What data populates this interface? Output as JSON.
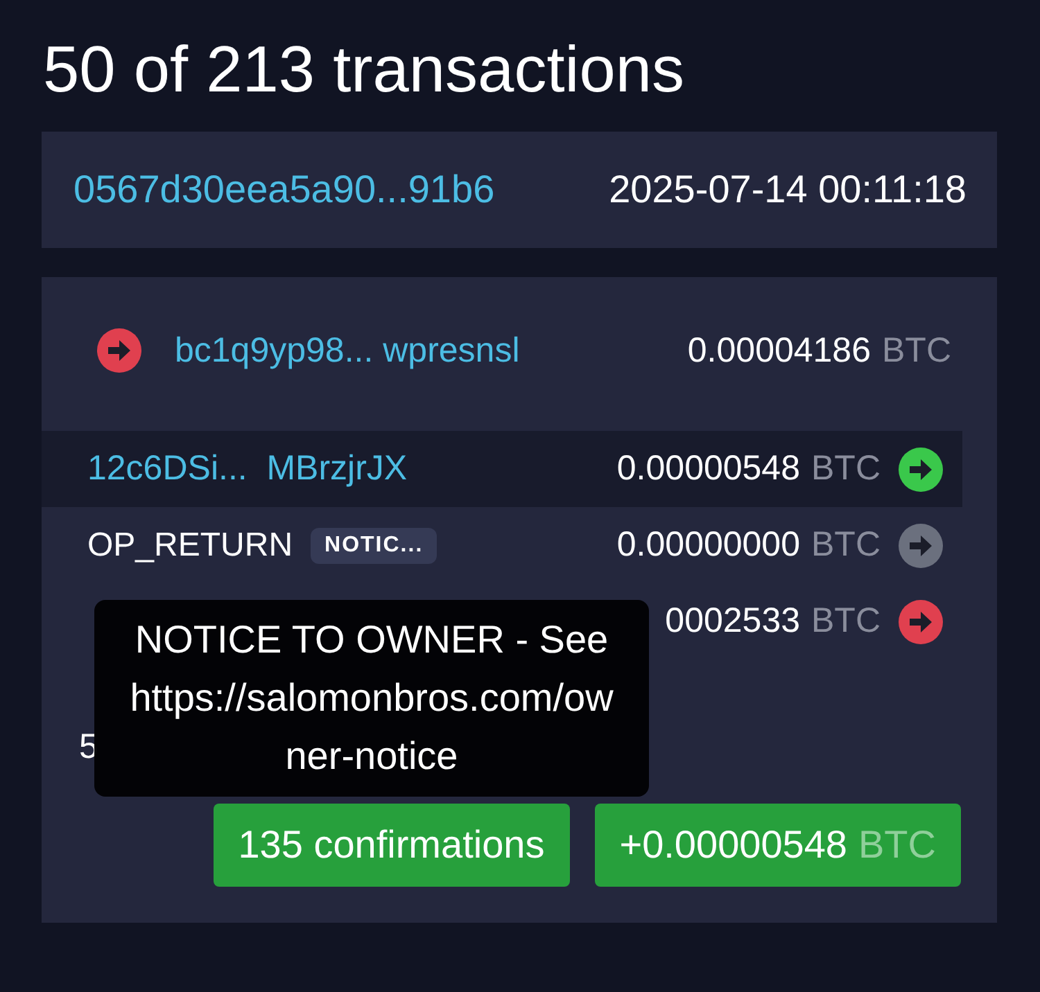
{
  "title": "50 of 213 transactions",
  "transaction": {
    "txid": "0567d30eea5a90...91b6",
    "time": "2025-07-14 00:11:18"
  },
  "inputs": [
    {
      "address": "bc1q9yp98... wpresnsl",
      "amount": "0.00004186",
      "unit": "BTC",
      "color": "#e0404f"
    }
  ],
  "outputs": [
    {
      "kind": "address",
      "address": "12c6DSi...  MBrzjrJX",
      "amount": "0.00000548",
      "unit": "BTC",
      "color": "#3ac84b",
      "selected": true
    },
    {
      "kind": "op_return",
      "label": "OP_RETURN",
      "badge": "NOTIC...",
      "amount": "0.00000000",
      "unit": "BTC",
      "color": "#6b707e",
      "selected": false
    },
    {
      "kind": "address",
      "amount": "0002533",
      "unit": "BTC",
      "color": "#e0404f",
      "selected": false
    }
  ],
  "fee": {
    "value": "5"
  },
  "tooltip": {
    "text": "NOTICE TO OWNER - See https://salomonbros.com/owner-notice"
  },
  "footer": {
    "confirmations": "135 confirmations",
    "balance": "+0.00000548",
    "unit": "BTC"
  }
}
